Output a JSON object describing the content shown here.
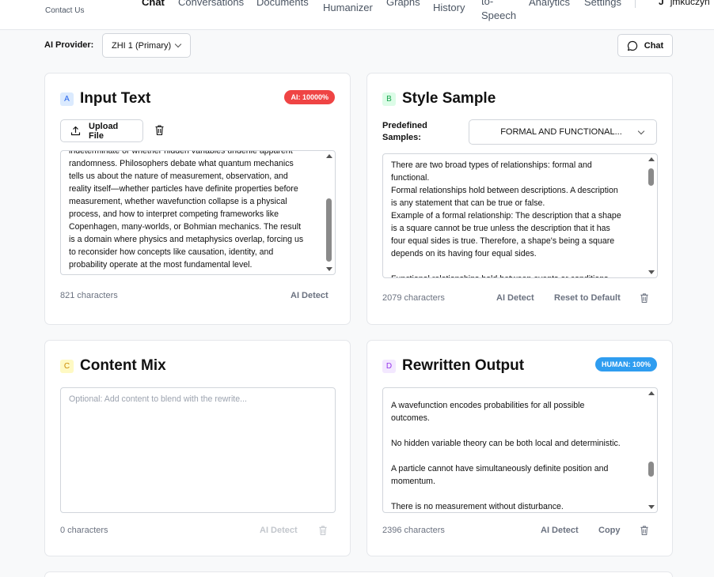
{
  "nav": {
    "contact": "Contact Us",
    "items": [
      {
        "label": "Chat"
      },
      {
        "label": "Conversations"
      },
      {
        "label": "Documents"
      },
      {
        "label": "Humanizer"
      },
      {
        "label": "Graphs"
      },
      {
        "label": "History"
      },
      {
        "label_line1": "to-",
        "label_line2": "Speech"
      },
      {
        "label": "Analytics"
      },
      {
        "label": "Settings"
      }
    ],
    "user": "jmkuczyn"
  },
  "provider": {
    "label": "AI Provider:",
    "selected": "ZHI 1 (Primary)"
  },
  "chat_button": "Chat",
  "input_card": {
    "letter": "A",
    "title": "Input Text",
    "badge": "AI: 10000%",
    "upload_label": "Upload File",
    "text": "indeterminate or whether hidden variables underlie apparent\nrandomness. Philosophers debate what quantum mechanics\ntells us about the nature of measurement, observation, and\nreality itself—whether particles have definite properties before\nmeasurement, whether wavefunction collapse is a physical\nprocess, and how to interpret competing frameworks like\nCopenhagen, many-worlds, or Bohmian mechanics. The result\nis a domain where physics and metaphysics overlap, forcing us\nto reconsider how concepts like causation, identity, and\nprobability operate at the most fundamental level.",
    "char_count": "821 characters",
    "ai_detect": "AI Detect",
    "scroll_fraction": 0.85
  },
  "style_card": {
    "letter": "B",
    "title": "Style Sample",
    "predefined_label_1": "Predefined",
    "predefined_label_2": "Samples:",
    "predefined_value": "FORMAL AND FUNCTIONAL...",
    "text": "There are two broad types of relationships: formal and\nfunctional.\nFormal relationships hold between descriptions. A description\nis any statement that can be true or false.\nExample of a formal relationship: The description that a shape\nis a square cannot be true unless the description that it has\nfour equal sides is true. Therefore, a shape's being a square\ndepends on its having four equal sides.\n\nFunctional relationships hold between events or conditions",
    "char_count": "2079 characters",
    "ai_detect": "AI Detect",
    "reset": "Reset to Default",
    "scroll_fraction": 0.0
  },
  "mix_card": {
    "letter": "C",
    "title": "Content Mix",
    "placeholder": "Optional: Add content to blend with the rewrite...",
    "char_count": "0 characters",
    "ai_detect": "AI Detect"
  },
  "output_card": {
    "letter": "D",
    "title": "Rewritten Output",
    "badge": "HUMAN: 100%",
    "text": "A wavefunction encodes probabilities for all possible\noutcomes.\n\nNo hidden variable theory can be both local and deterministic.\n\nA particle cannot have simultaneously definite position and\nmomentum.\n\nThere is no measurement without disturbance.",
    "char_count": "2396 characters",
    "ai_detect": "AI Detect",
    "copy": "Copy",
    "scroll_fraction": 0.6
  },
  "colors": {
    "ai_badge": "#ef4444",
    "human_badge": "#2f9df0",
    "letter_a_bg": "#dbeafe",
    "letter_a_fg": "#2563eb",
    "letter_b_bg": "#dcfce7",
    "letter_b_fg": "#16a34a",
    "letter_c_bg": "#fef9c3",
    "letter_c_fg": "#ca8a04",
    "letter_d_bg": "#f3e8ff",
    "letter_d_fg": "#9333ea"
  }
}
